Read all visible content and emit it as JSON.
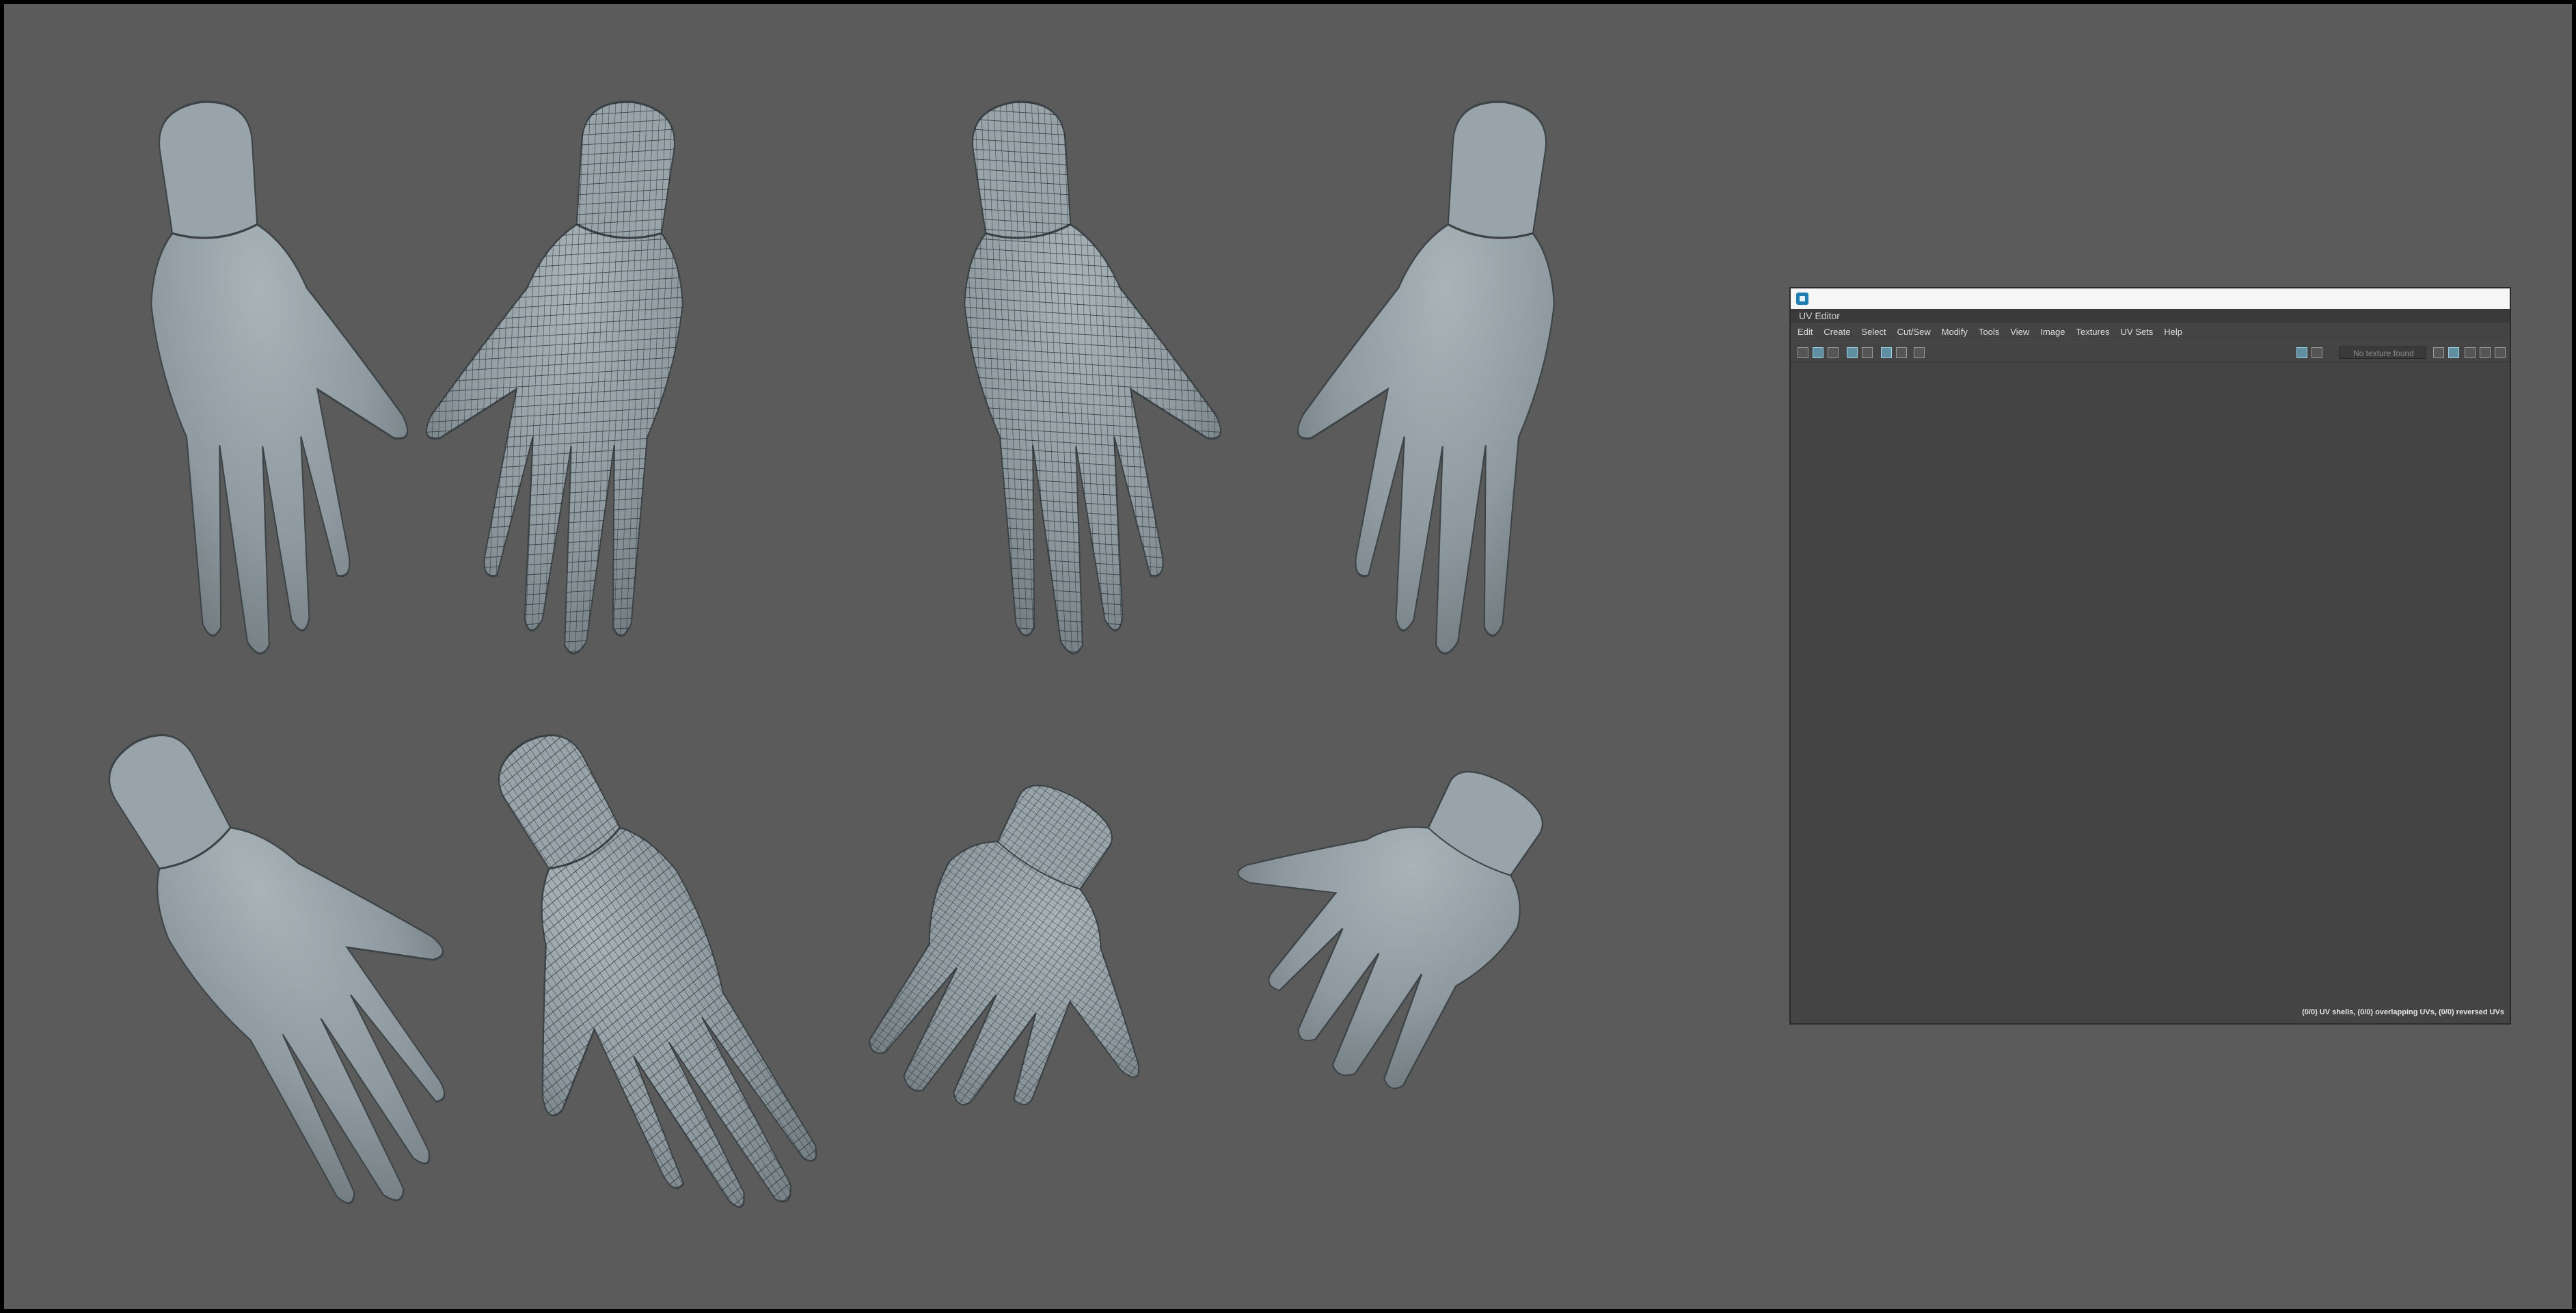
{
  "colors": {
    "viewport_bg": "#5b5b5b",
    "frame_border": "#000000",
    "mesh_fill": "#8e9aa0",
    "mesh_wire": "#1a1f22",
    "uv_shell_fill": "#3a4ad8",
    "uv_grid_line": "#d8dcff",
    "uv_editor_bg": "#444444"
  },
  "uv_editor": {
    "title": "UV Editor",
    "menus": [
      "Edit",
      "Create",
      "Select",
      "Cut/Sew",
      "Modify",
      "Tools",
      "View",
      "Image",
      "Textures",
      "UV Sets",
      "Help"
    ],
    "texture_dropdown_placeholder": "No texture found",
    "status_text": "(0/0) UV shells, (0/0) overlapping UVs, (0/0) reversed UVs",
    "icons": [
      "uv-toolkit-icon",
      "grid-icon",
      "filter-icon",
      "shaded-icon",
      "checker-icon",
      "isolate-icon",
      "pin-icon",
      "snapshot-icon",
      "image-icon",
      "texture-icon",
      "exposure-icon",
      "gamma-icon",
      "color-icon",
      "pixel-snap-icon",
      "toggle-icon"
    ]
  },
  "hands": [
    {
      "view": "palm",
      "wireframe": false
    },
    {
      "view": "back",
      "wireframe": true
    },
    {
      "view": "palm",
      "wireframe": true
    },
    {
      "view": "back",
      "wireframe": false
    },
    {
      "view": "side",
      "wireframe": false
    },
    {
      "view": "side",
      "wireframe": true
    },
    {
      "view": "down",
      "wireframe": true
    },
    {
      "view": "down",
      "wireframe": false
    }
  ]
}
